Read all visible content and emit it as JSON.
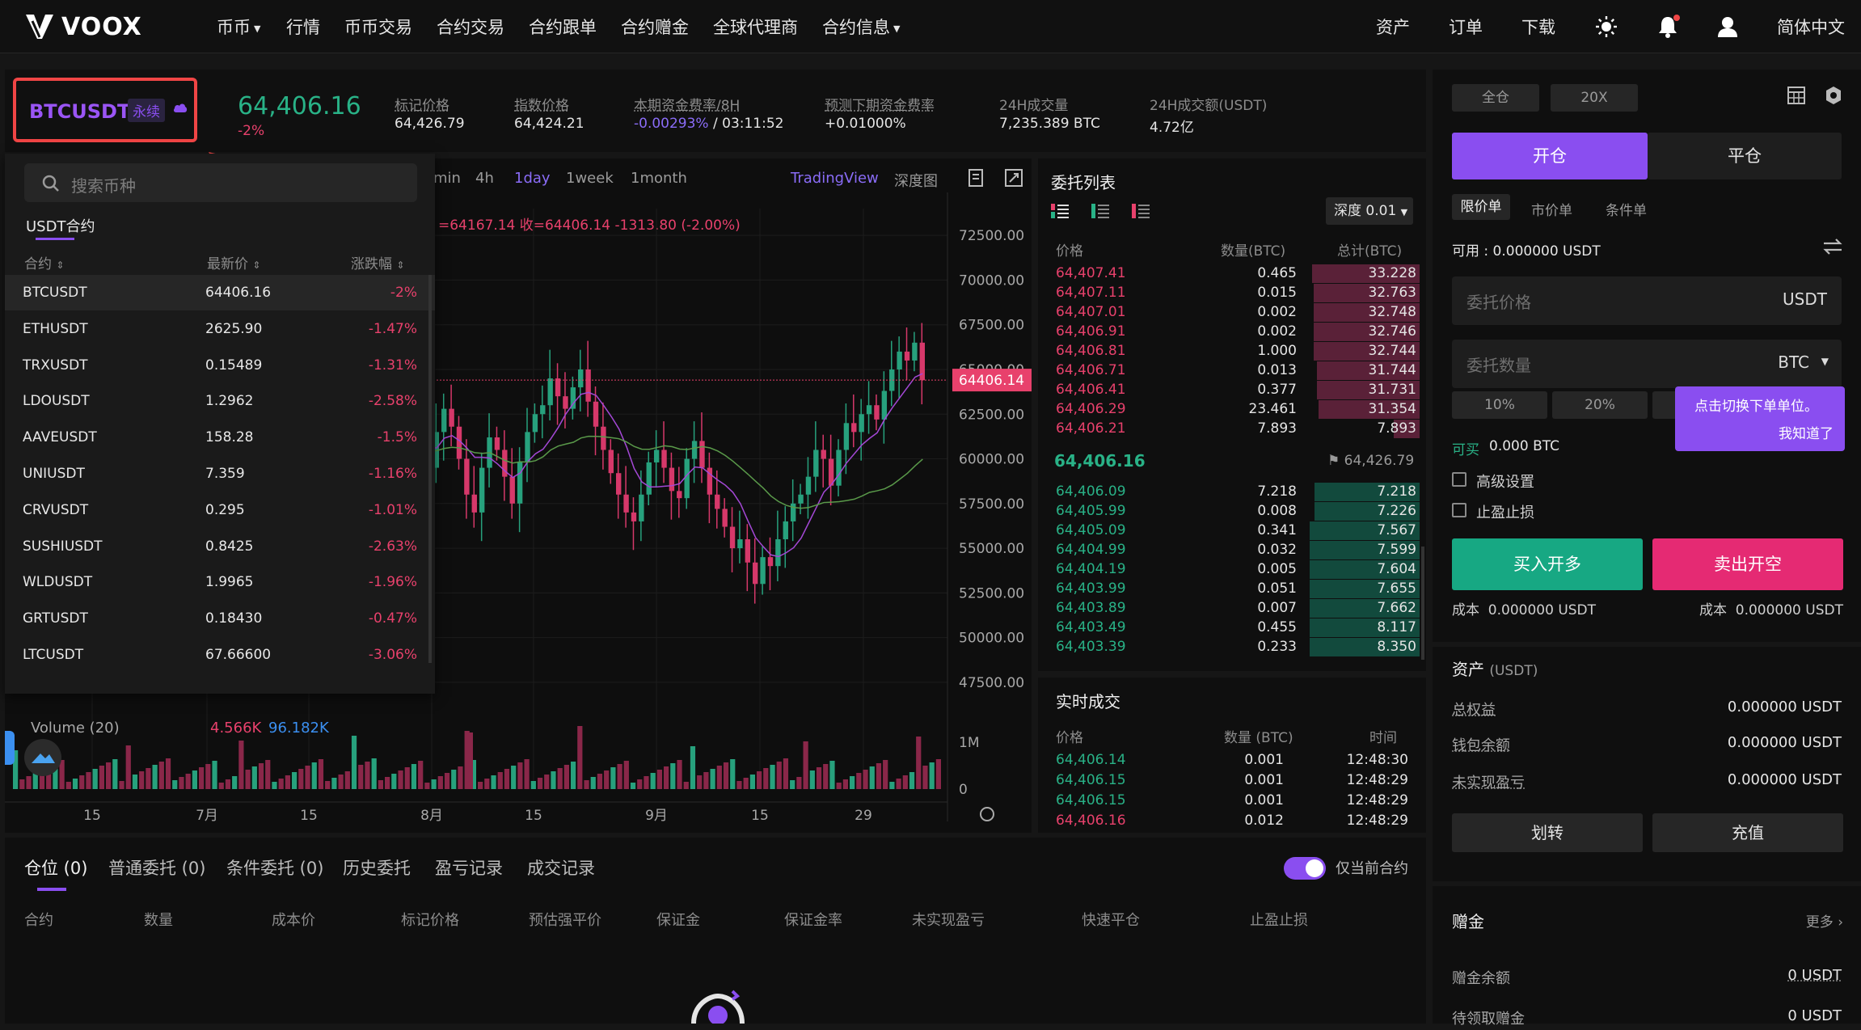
{
  "nav": {
    "brand": "VOOX",
    "items": [
      "币币",
      "行情",
      "币币交易",
      "合约交易",
      "合约跟单",
      "合约赠金",
      "全球代理商",
      "合约信息"
    ],
    "right": [
      "资产",
      "订单",
      "下载"
    ],
    "language": "简体中文"
  },
  "ticker": {
    "symbol": "BTCUSDT",
    "badge": "永续",
    "price": "64,406.16",
    "change": "-2%",
    "stats": [
      {
        "label": "标记价格",
        "value": "64,426.79"
      },
      {
        "label": "指数价格",
        "value": "64,424.21"
      },
      {
        "label": "本期资金费率/8H",
        "value": "-0.00293%",
        "value2": " / 03:11:52"
      },
      {
        "label": "预测下期资金费率",
        "value": "+0.01000%"
      },
      {
        "label": "24H成交量",
        "value": "7,235.389 BTC"
      },
      {
        "label": "24H成交额(USDT)",
        "value": "4.72亿"
      }
    ]
  },
  "chart": {
    "timeframes": [
      "min",
      "4h",
      "1day",
      "1week",
      "1month"
    ],
    "active_tf": "1day",
    "tradingview": "TradingView",
    "depth": "深度图",
    "ohlc_text": "=64167.14  收=64406.14  -1313.80 (-2.00%)",
    "price_label": "64406.14",
    "y_ticks": [
      "72500.00",
      "70000.00",
      "67500.00",
      "65000.00",
      "62500.00",
      "60000.00",
      "57500.00",
      "55000.00",
      "52500.00",
      "50000.00",
      "47500.00"
    ],
    "vol_ticks": [
      "1M",
      "0"
    ],
    "x_ticks": [
      "15",
      "7月",
      "15",
      "8月",
      "15",
      "9月",
      "15",
      "29"
    ],
    "volume_label": "Volume (20)",
    "vol1": "4.566K",
    "vol2": "96.182K"
  },
  "dropdown": {
    "search_placeholder": "搜索币种",
    "tab": "USDT合约",
    "headers": [
      "合约",
      "最新价",
      "涨跌幅"
    ],
    "rows": [
      {
        "sym": "BTCUSDT",
        "price": "64406.16",
        "chg": "-2%"
      },
      {
        "sym": "ETHUSDT",
        "price": "2625.90",
        "chg": "-1.47%"
      },
      {
        "sym": "TRXUSDT",
        "price": "0.15489",
        "chg": "-1.31%"
      },
      {
        "sym": "LDOUSDT",
        "price": "1.2962",
        "chg": "-2.58%"
      },
      {
        "sym": "AAVEUSDT",
        "price": "158.28",
        "chg": "-1.5%"
      },
      {
        "sym": "UNIUSDT",
        "price": "7.359",
        "chg": "-1.16%"
      },
      {
        "sym": "CRVUSDT",
        "price": "0.295",
        "chg": "-1.01%"
      },
      {
        "sym": "SUSHIUSDT",
        "price": "0.8425",
        "chg": "-2.63%"
      },
      {
        "sym": "WLDUSDT",
        "price": "1.9965",
        "chg": "-1.96%"
      },
      {
        "sym": "GRTUSDT",
        "price": "0.18430",
        "chg": "-0.47%"
      },
      {
        "sym": "LTCUSDT",
        "price": "67.66600",
        "chg": "-3.06%"
      }
    ]
  },
  "orderbook": {
    "title": "委托列表",
    "depth": "深度 0.01",
    "headers": [
      "价格",
      "数量(BTC)",
      "总计(BTC)"
    ],
    "asks": [
      [
        "64,407.41",
        "0.465",
        "33.228"
      ],
      [
        "64,407.11",
        "0.015",
        "32.763"
      ],
      [
        "64,407.01",
        "0.002",
        "32.748"
      ],
      [
        "64,406.91",
        "0.002",
        "32.746"
      ],
      [
        "64,406.81",
        "1.000",
        "32.744"
      ],
      [
        "64,406.71",
        "0.013",
        "31.744"
      ],
      [
        "64,406.41",
        "0.377",
        "31.731"
      ],
      [
        "64,406.29",
        "23.461",
        "31.354"
      ],
      [
        "64,406.21",
        "7.893",
        "7.893"
      ]
    ],
    "mid_price": "64,406.16",
    "mark_price": "64,426.79",
    "bids": [
      [
        "64,406.09",
        "7.218",
        "7.218"
      ],
      [
        "64,405.99",
        "0.008",
        "7.226"
      ],
      [
        "64,405.09",
        "0.341",
        "7.567"
      ],
      [
        "64,404.99",
        "0.032",
        "7.599"
      ],
      [
        "64,404.19",
        "0.005",
        "7.604"
      ],
      [
        "64,403.99",
        "0.051",
        "7.655"
      ],
      [
        "64,403.89",
        "0.007",
        "7.662"
      ],
      [
        "64,403.49",
        "0.455",
        "8.117"
      ],
      [
        "64,403.39",
        "0.233",
        "8.350"
      ]
    ]
  },
  "trades": {
    "title": "实时成交",
    "headers": [
      "价格",
      "数量 (BTC)",
      "时间"
    ],
    "rows": [
      [
        "64,406.14",
        "0.001",
        "12:48:30",
        "buy"
      ],
      [
        "64,406.15",
        "0.001",
        "12:48:29",
        "buy"
      ],
      [
        "64,406.15",
        "0.001",
        "12:48:29",
        "buy"
      ],
      [
        "64,406.16",
        "0.012",
        "12:48:29",
        "sell"
      ]
    ]
  },
  "bottom": {
    "tabs": [
      "仓位 (0)",
      "普通委托 (0)",
      "条件委托 (0)",
      "历史委托",
      "盈亏记录",
      "成交记录"
    ],
    "toggle_label": "仅当前合约",
    "columns": [
      "合约",
      "数量",
      "成本价",
      "标记价格",
      "预估强平价",
      "保证金",
      "保证金率",
      "未实现盈亏",
      "快速平仓",
      "止盈止损"
    ]
  },
  "order": {
    "margin_mode": "全仓",
    "leverage": "20X",
    "open": "开仓",
    "close": "平仓",
    "types": [
      "限价单",
      "市价单",
      "条件单"
    ],
    "available": "可用 : 0.000000 USDT",
    "price_placeholder": "委托价格",
    "price_unit": "USDT",
    "qty_placeholder": "委托数量",
    "qty_unit": "BTC",
    "pcts": [
      "10%",
      "20%"
    ],
    "tooltip_line1": "点击切换下单单位。",
    "tooltip_line2": "我知道了",
    "can_buy_label": "可买",
    "can_buy_value": "0.000 BTC",
    "advanced": "高级设置",
    "tpsl": "止盈止损",
    "buy_btn": "买入开多",
    "sell_btn": "卖出开空",
    "cost_left": "成本  0.000000 USDT",
    "cost_right": "成本  0.000000 USDT"
  },
  "assets": {
    "title": "资产",
    "unit": "(USDT)",
    "rows": [
      {
        "label": "总权益",
        "value": "0.000000 USDT"
      },
      {
        "label": "钱包余额",
        "value": "0.000000 USDT"
      },
      {
        "label": "未实现盈亏",
        "value": "0.000000 USDT"
      }
    ],
    "transfer": "划转",
    "deposit": "充值"
  },
  "bonus": {
    "title": "赠金",
    "more": "更多",
    "rows": [
      {
        "label": "赠金余额",
        "value": "0 USDT"
      },
      {
        "label": "待领取赠金",
        "value": "0 USDT"
      }
    ]
  },
  "colors": {
    "accent": "#8a4ef0",
    "up": "#29b287",
    "down": "#e8416c",
    "highlight": "#f04545"
  }
}
